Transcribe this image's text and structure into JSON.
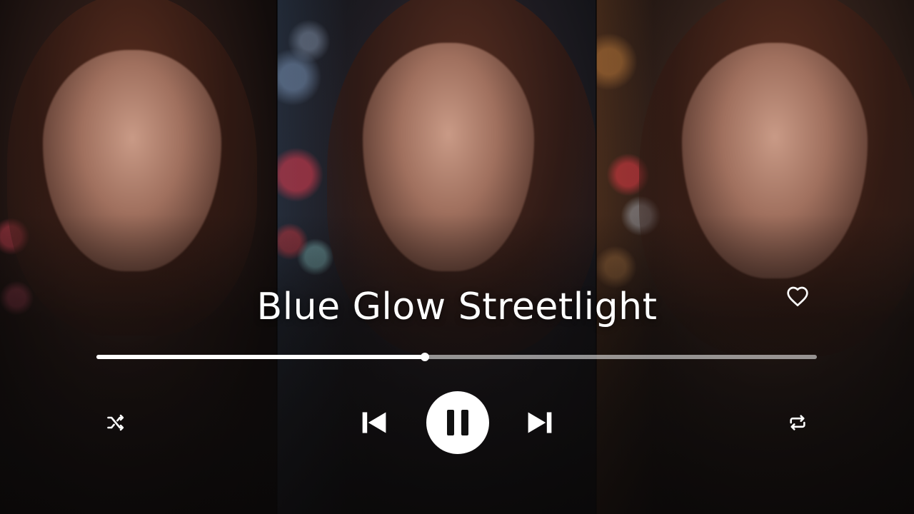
{
  "player": {
    "song_title": "Blue Glow Streetlight",
    "progress": 0.456,
    "icons": {
      "like": "heart-outline-icon",
      "shuffle": "shuffle-icon",
      "previous": "skip-previous-icon",
      "play_pause": "pause-icon",
      "next": "skip-next-icon",
      "repeat": "repeat-icon"
    },
    "colors": {
      "accent": "#ffffff",
      "track": "#bdbdbd",
      "background": "#0b0b0d"
    }
  }
}
